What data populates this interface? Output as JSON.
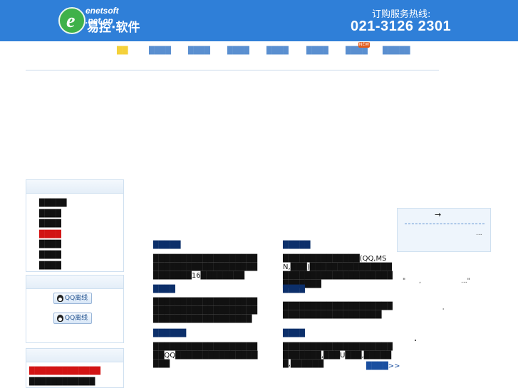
{
  "header": {
    "logo_letter": "e",
    "logo_domain": "enetsoft .net.cn",
    "logo_cn": "易控·软件",
    "hotline_label": "订购服务热线:",
    "hotline_number": "021-3126 2301"
  },
  "nav": {
    "items": [
      "██",
      "████",
      "████",
      "████",
      "████",
      "████",
      "████",
      "█████"
    ],
    "badge": "NEW"
  },
  "left": {
    "links": [
      "█████",
      "████",
      "████",
      "████",
      "████",
      "████",
      "████"
    ],
    "qq_buttons": [
      "QQ离线",
      "QQ离线"
    ],
    "bottom_lines": [
      "█████████████",
      "████████████"
    ]
  },
  "articles": {
    "left": [
      {
        "title": "█████",
        "body": "█████████████████████████████████████████████16████████"
      },
      {
        "title": "████",
        "body": "████████████████████████████████████████████████████████"
      },
      {
        "title": "██████",
        "body": "█████████████████████QQ██████████████████"
      }
    ],
    "right": [
      {
        "title": "█████",
        "body": "██████████████(QQ,MSN,███)██████████████████████████████████████████"
      },
      {
        "title": "████",
        "body": "██████████████████████████████████████"
      },
      {
        "title": "████",
        "body": "███████████████████████████,███U███,██████,██████"
      }
    ],
    "more": "████>>"
  },
  "right": {
    "arrow": "→",
    "ellipsis": "...",
    "quote_open": "\"",
    "quote_mid": ",",
    "quote_close": "...\"",
    "tick": "'"
  }
}
